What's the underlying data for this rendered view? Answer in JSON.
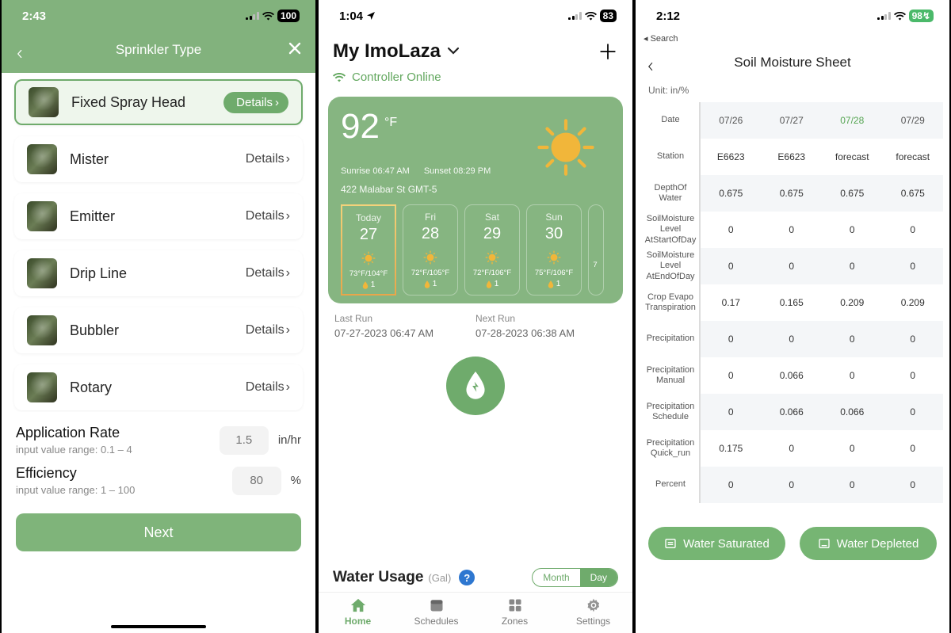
{
  "a": {
    "time": "2:43",
    "battery": "100",
    "title": "Sprinkler Type",
    "items": [
      {
        "name": "Fixed Spray Head",
        "detail": "Details",
        "selected": true
      },
      {
        "name": "Mister",
        "detail": "Details"
      },
      {
        "name": "Emitter",
        "detail": "Details"
      },
      {
        "name": "Drip Line",
        "detail": "Details"
      },
      {
        "name": "Bubbler",
        "detail": "Details"
      },
      {
        "name": "Rotary",
        "detail": "Details"
      }
    ],
    "app_rate_label": "Application Rate",
    "app_rate_sub": "input value range: 0.1 – 4",
    "app_rate_ph": "1.5",
    "app_rate_unit": "in/hr",
    "eff_label": "Efficiency",
    "eff_sub": "input value range: 1 – 100",
    "eff_ph": "80",
    "eff_unit": "%",
    "next": "Next"
  },
  "b": {
    "time": "1:04",
    "battery": "83",
    "title": "My ImoLaza",
    "status": "Controller Online",
    "temp": "92",
    "deg": "°F",
    "sunrise": "Sunrise 06:47 AM",
    "sunset": "Sunset 08:29 PM",
    "loc": "422 Malabar St  GMT-5",
    "days": [
      {
        "name": "Today",
        "num": "27",
        "temps": "73°F/104°F",
        "rain": "1"
      },
      {
        "name": "Fri",
        "num": "28",
        "temps": "72°F/105°F",
        "rain": "1"
      },
      {
        "name": "Sat",
        "num": "29",
        "temps": "72°F/106°F",
        "rain": "1"
      },
      {
        "name": "Sun",
        "num": "30",
        "temps": "75°F/106°F",
        "rain": "1"
      }
    ],
    "partial": "7",
    "last_label": "Last Run",
    "last_val": "07-27-2023 06:47 AM",
    "next_label": "Next Run",
    "next_val": "07-28-2023 06:38 AM",
    "usage_title": "Water Usage",
    "usage_unit": "(Gal)",
    "seg_month": "Month",
    "seg_day": "Day",
    "tabs": [
      "Home",
      "Schedules",
      "Zones",
      "Settings"
    ]
  },
  "c": {
    "time": "2:12",
    "battery": "98↯",
    "search": "◂ Search",
    "title": "Soil Moisture Sheet",
    "unit": "Unit: in/%",
    "cols": [
      "07/26",
      "07/27",
      "07/28",
      "07/29"
    ],
    "hlcol": 2,
    "rows": [
      {
        "h": "Date",
        "v": [
          "07/26",
          "07/27",
          "07/28",
          "07/29"
        ]
      },
      {
        "h": "Station",
        "v": [
          "E6623",
          "E6623",
          "forecast",
          "forecast"
        ]
      },
      {
        "h": "DepthOf Water",
        "v": [
          "0.675",
          "0.675",
          "0.675",
          "0.675"
        ]
      },
      {
        "h": "SoilMoisture Level AtStartOfDay",
        "v": [
          "0",
          "0",
          "0",
          "0"
        ]
      },
      {
        "h": "SoilMoisture Level AtEndOfDay",
        "v": [
          "0",
          "0",
          "0",
          "0"
        ]
      },
      {
        "h": "Crop Evapo Transpiration",
        "v": [
          "0.17",
          "0.165",
          "0.209",
          "0.209"
        ]
      },
      {
        "h": "Precipitation",
        "v": [
          "0",
          "0",
          "0",
          "0"
        ]
      },
      {
        "h": "Precipitation Manual",
        "v": [
          "0",
          "0.066",
          "0",
          "0"
        ]
      },
      {
        "h": "Precipitation Schedule",
        "v": [
          "0",
          "0.066",
          "0.066",
          "0"
        ]
      },
      {
        "h": "Precipitation Quick_run",
        "v": [
          "0.175",
          "0",
          "0",
          "0"
        ]
      },
      {
        "h": "Percent",
        "v": [
          "0",
          "0",
          "0",
          "0"
        ]
      }
    ],
    "btn1": "Water Saturated",
    "btn2": "Water Depleted"
  }
}
